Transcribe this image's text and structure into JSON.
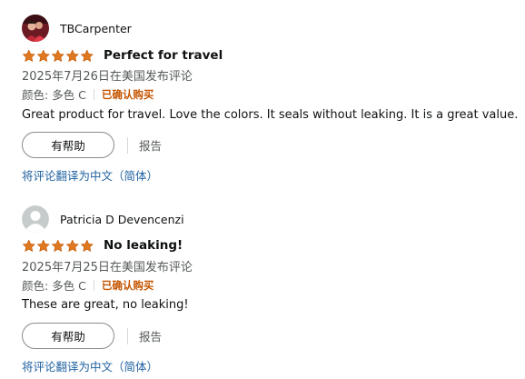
{
  "reviews": [
    {
      "profile_name": "TBCarpenter",
      "rating": 5,
      "title": "Perfect for travel",
      "date": "2025年7月26日在美国发布评论",
      "format": "颜色: 多色 C",
      "verified": "已确认购买",
      "body": "Great product for travel. Love the colors. It seals without leaking. It is a great value.",
      "helpful_label": "有帮助",
      "report_label": "报告",
      "translate_label": "将评论翻译为中文（简体）",
      "avatar": "photo-avatar"
    },
    {
      "profile_name": "Patricia D Devencenzi",
      "rating": 5,
      "title": "No leaking!",
      "date": "2025年7月25日在美国发布评论",
      "format": "颜色: 多色 C",
      "verified": "已确认购买",
      "body": "These are great, no leaking!",
      "helpful_label": "有帮助",
      "report_label": "报告",
      "translate_label": "将评论翻译为中文（简体）",
      "avatar": "default-user-icon"
    }
  ],
  "colors": {
    "star": "#de7921",
    "verified": "#c45500",
    "link": "#2162a1",
    "muted": "#565959"
  }
}
